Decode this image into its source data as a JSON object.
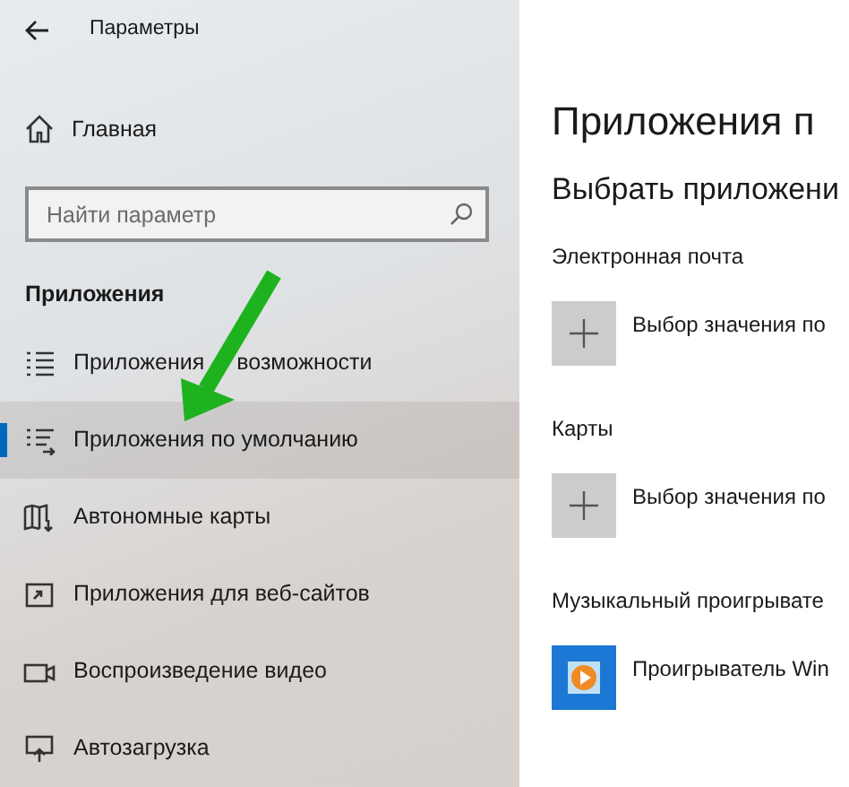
{
  "window": {
    "title": "Параметры"
  },
  "sidebar": {
    "home": "Главная",
    "search": {
      "placeholder": "Найти параметр"
    },
    "section": "Приложения",
    "items": [
      {
        "label": "Приложения",
        "label_after_arrow": "возможности",
        "selected": false
      },
      {
        "label": "Приложения по умолчанию",
        "selected": true
      },
      {
        "label": "Автономные карты",
        "selected": false
      },
      {
        "label": "Приложения для веб-сайтов",
        "selected": false
      },
      {
        "label": "Воспроизведение видео",
        "selected": false
      },
      {
        "label": "Автозагрузка",
        "selected": false
      }
    ]
  },
  "content": {
    "title": "Приложения п",
    "subtitle": "Выбрать приложени",
    "groups": [
      {
        "label": "Электронная почта",
        "app": "Выбор значения по",
        "kind": "plus"
      },
      {
        "label": "Карты",
        "app": "Выбор значения по",
        "kind": "plus"
      },
      {
        "label": "Музыкальный проигрывате",
        "app": "Проигрыватель Win",
        "kind": "player"
      }
    ]
  }
}
